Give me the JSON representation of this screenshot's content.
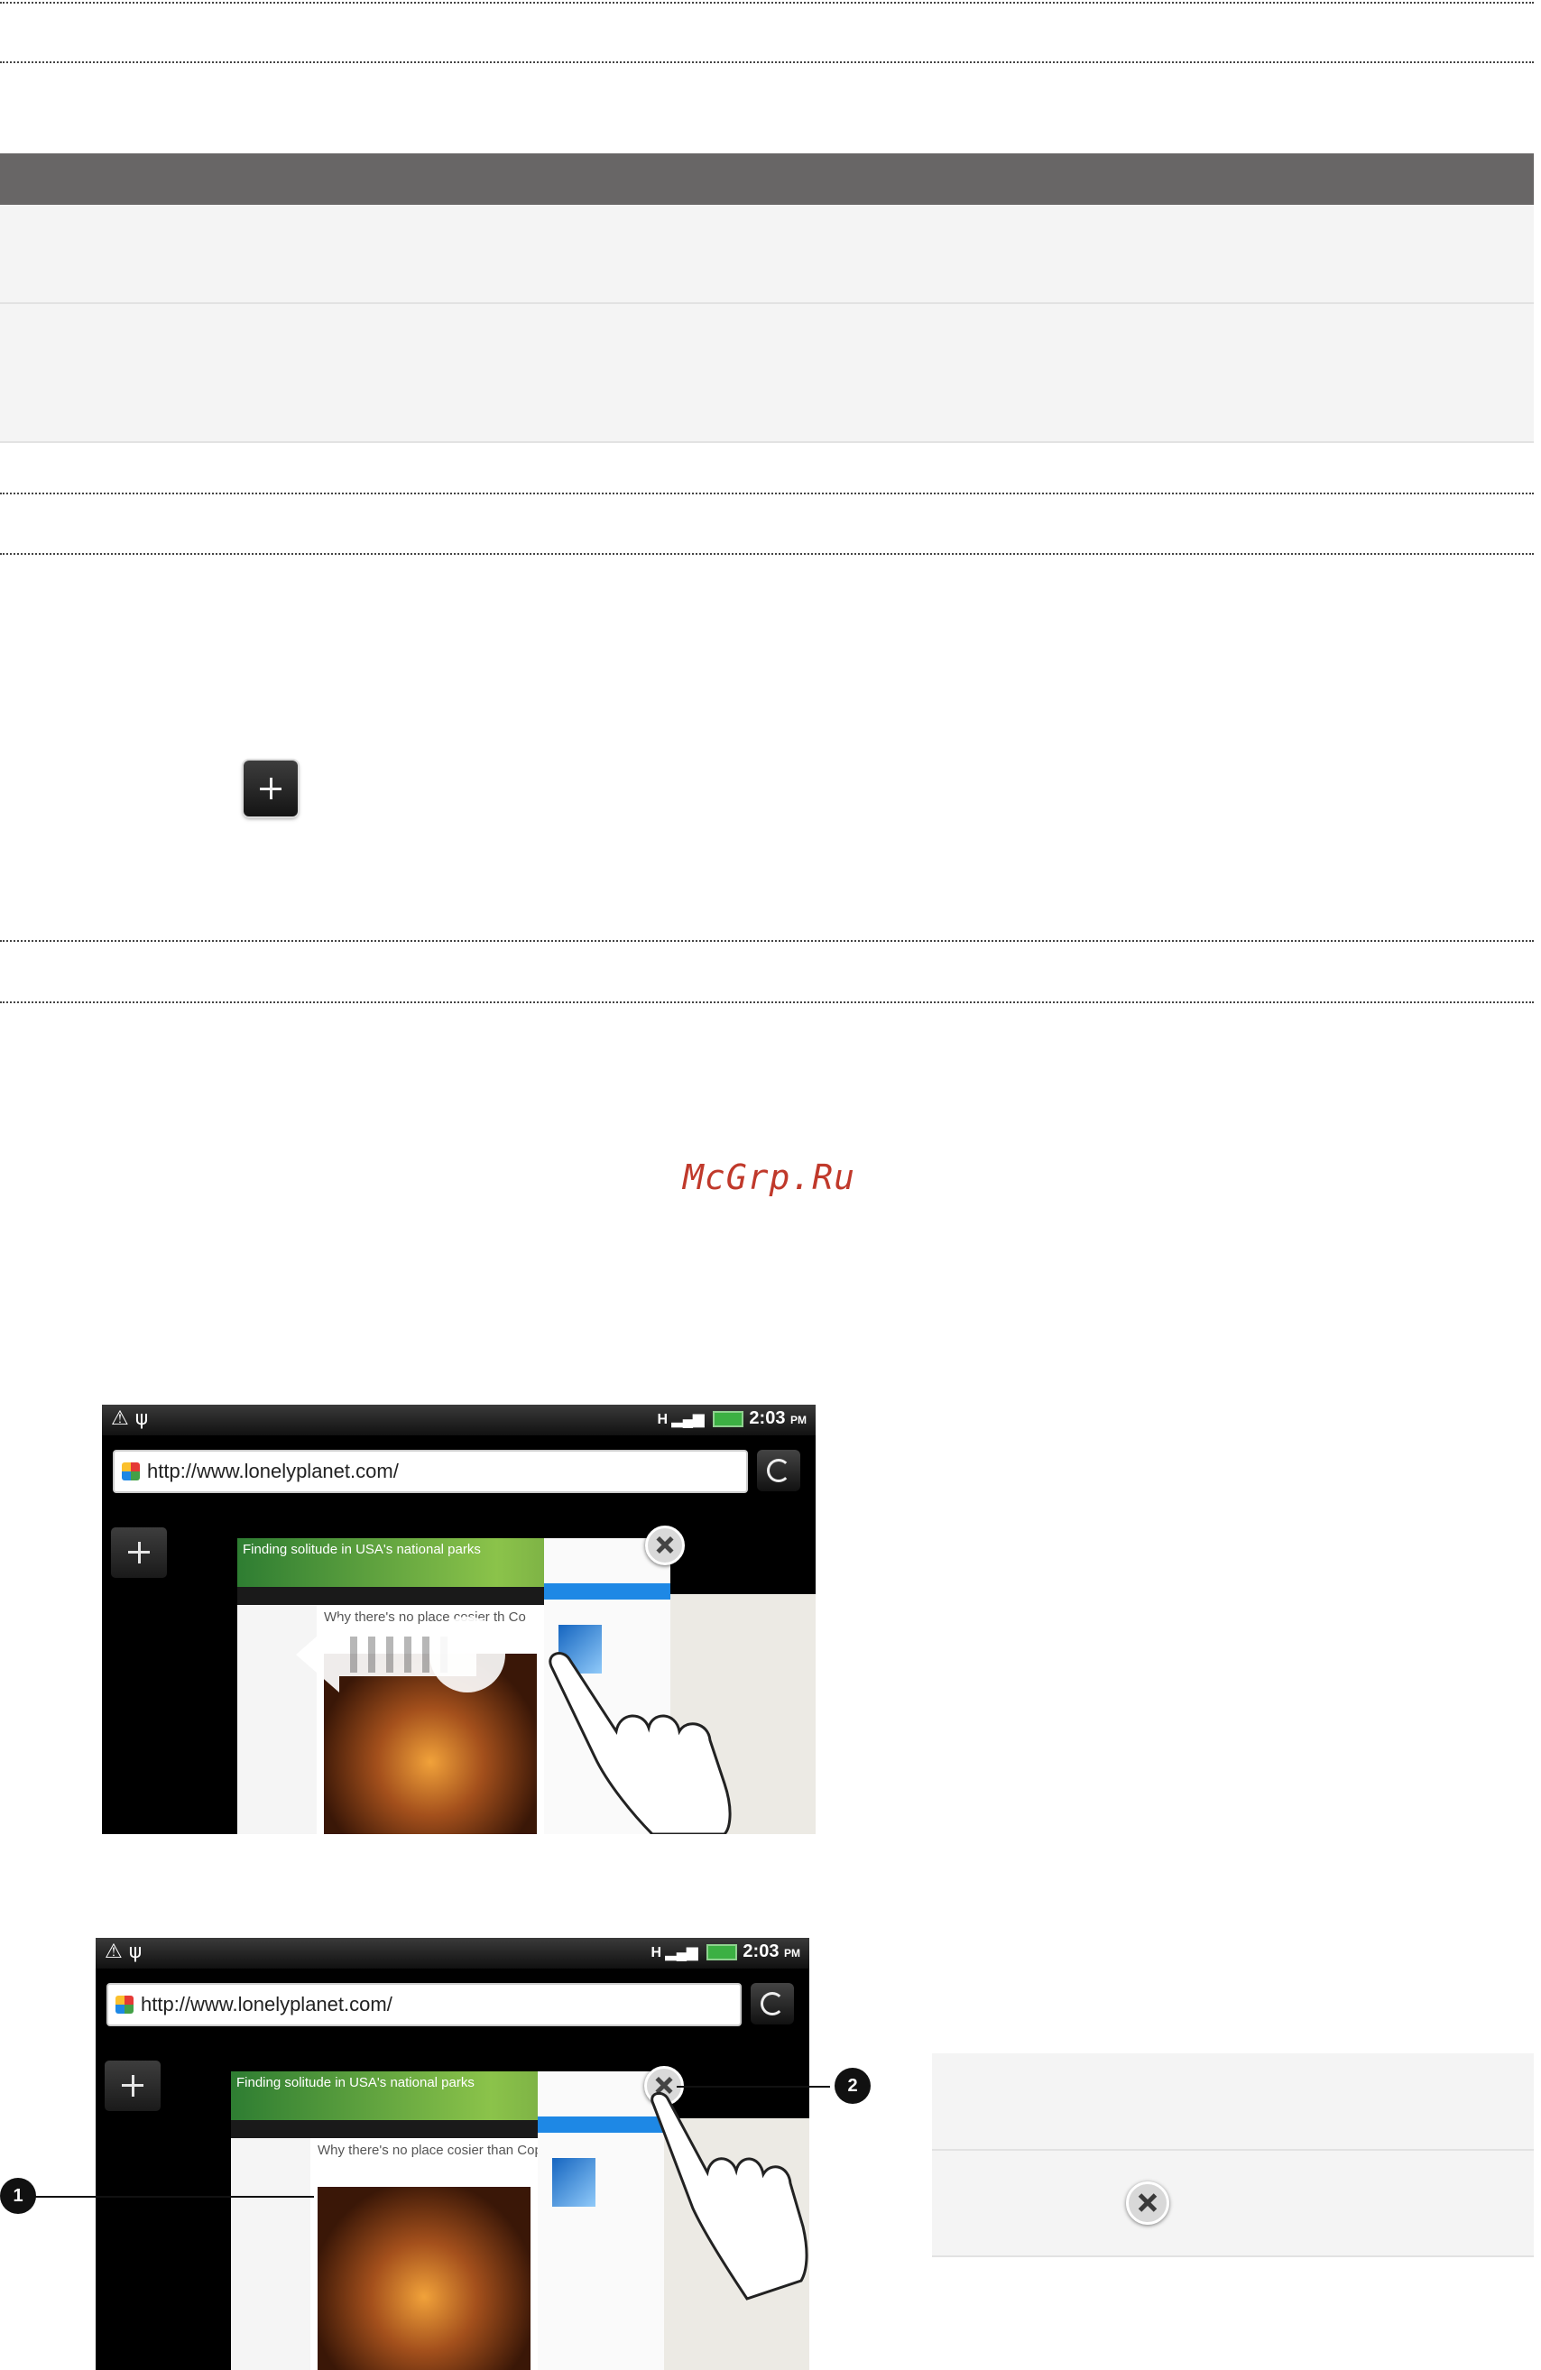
{
  "watermark": "McGrp.Ru",
  "screenshots": [
    {
      "url": "http://www.lonelyplanet.com/",
      "time": "2:03",
      "ampm": "PM",
      "banner": "Finding solitude in USA's national parks",
      "headline": "Why there's no place cosier th Co"
    },
    {
      "url": "http://www.lonelyplanet.com/",
      "time": "2:03",
      "ampm": "PM",
      "banner": "Finding solitude in USA's national parks",
      "headline": "Why there's no place cosier than Copenhagen"
    }
  ],
  "callouts": {
    "one": "1",
    "two": "2"
  },
  "icons": {
    "new_tab": "plus-icon",
    "refresh": "refresh-icon",
    "close": "close-icon",
    "swipe": "swipe-left-arrow-icon",
    "hand": "hand-pointer-icon"
  }
}
